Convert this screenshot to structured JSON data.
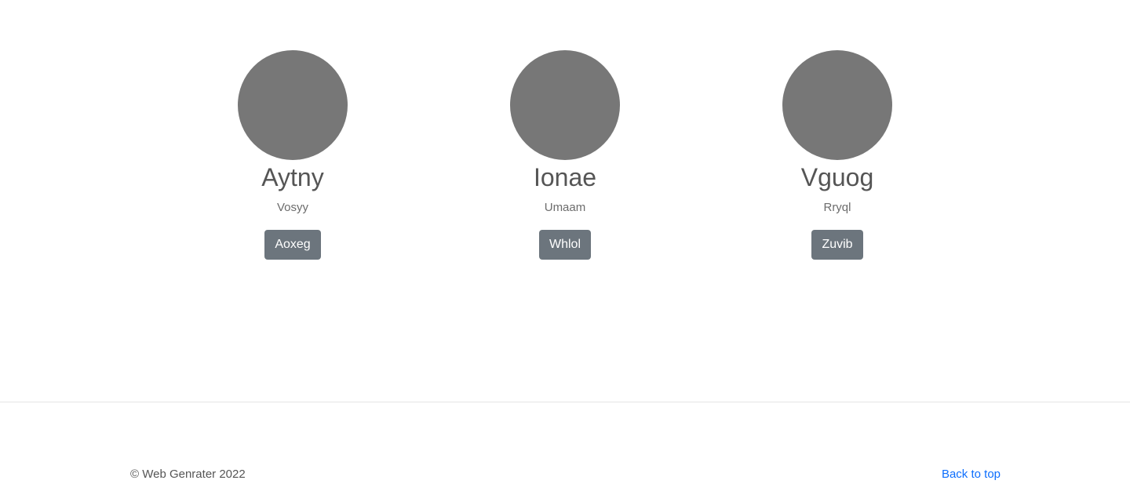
{
  "cards": [
    {
      "name": "Aytny",
      "subtitle": "Vosyy",
      "button": "Aoxeg"
    },
    {
      "name": "Ionae",
      "subtitle": "Umaam",
      "button": "Whlol"
    },
    {
      "name": "Vguog",
      "subtitle": "Rryql",
      "button": "Zuvib"
    }
  ],
  "footer": {
    "copyright": "© Web Genrater 2022",
    "back_to_top": "Back to top"
  },
  "colors": {
    "avatar": "#777777",
    "button": "#6c757d",
    "link": "#0d6efd"
  }
}
